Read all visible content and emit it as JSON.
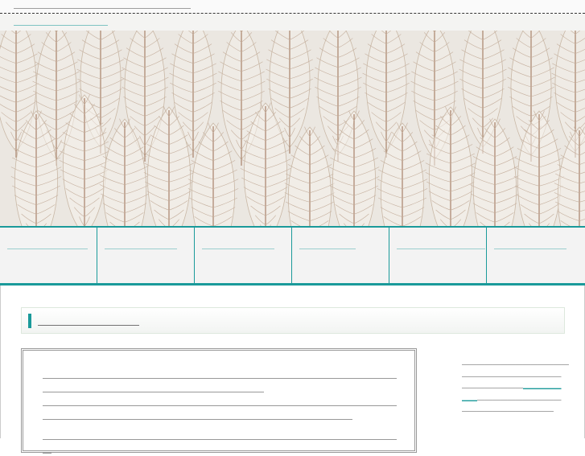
{
  "header": {
    "tagline": "＿＿＿＿＿＿＿＿＿＿＿＿＿＿＿＿＿＿＿＿＿＿",
    "site_title": "＿＿＿＿＿＿＿＿＿"
  },
  "nav": {
    "items": [
      {
        "label": "＿＿＿＿＿＿＿＿＿＿"
      },
      {
        "label": "＿＿＿＿＿＿＿＿＿"
      },
      {
        "label": "＿＿＿＿＿＿＿＿＿"
      },
      {
        "label": "＿＿＿＿＿＿＿"
      },
      {
        "label": "＿＿＿＿＿＿＿＿＿＿＿"
      },
      {
        "label": "＿＿＿＿＿＿＿＿＿"
      }
    ]
  },
  "main": {
    "heading": "＿＿＿＿＿＿＿＿＿",
    "paragraphs": [
      "＿＿＿＿＿＿＿＿＿＿＿＿＿＿＿＿＿＿＿＿＿＿＿＿＿＿＿＿＿＿＿＿＿＿＿＿＿＿＿＿＿＿＿＿＿＿＿＿＿＿＿＿＿＿＿＿＿＿＿＿＿＿＿＿＿",
      "＿＿＿＿＿＿＿＿＿＿＿＿＿＿＿＿＿＿＿＿＿＿＿＿＿＿＿＿＿＿＿＿＿＿＿＿＿＿＿＿＿＿＿＿＿＿＿＿＿＿＿＿＿＿＿＿＿＿＿＿＿＿＿＿＿＿＿＿＿＿＿＿＿＿＿",
      "＿＿＿＿＿＿＿＿＿＿＿＿＿＿＿＿＿＿＿＿＿＿＿＿＿＿＿＿＿＿＿＿＿＿＿＿＿＿＿＿＿"
    ]
  },
  "sidebar": {
    "line1": "＿＿＿＿＿＿＿＿＿＿＿＿＿＿",
    "line2_prefix": "＿＿＿＿＿＿＿＿＿＿＿＿＿＿＿＿＿＿＿＿＿",
    "line2_link": "＿＿＿＿＿＿＿",
    "line2_suffix": "＿＿＿＿＿＿＿＿＿＿＿＿＿＿＿＿＿＿＿＿＿＿＿"
  },
  "colors": {
    "accent": "#1a9a9a",
    "hero_bg": "#ece8e2"
  }
}
